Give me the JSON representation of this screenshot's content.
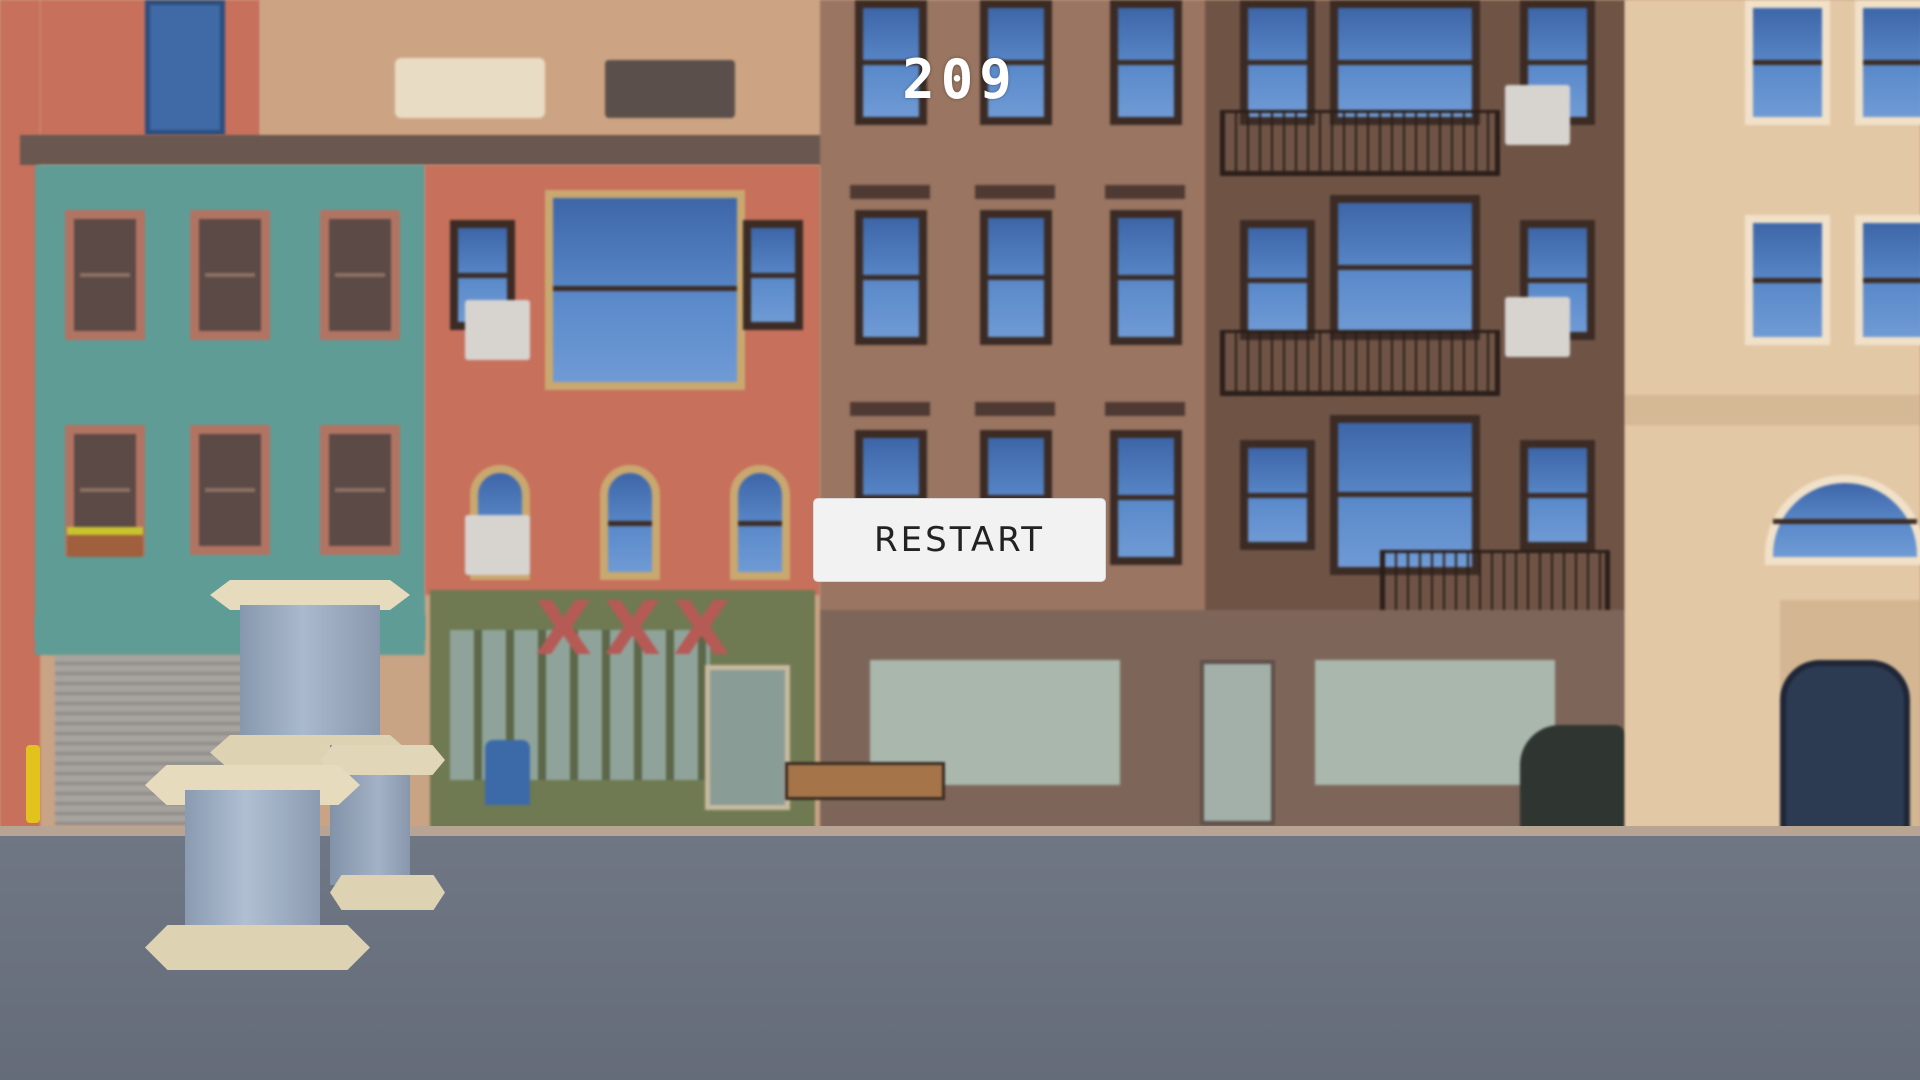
{
  "hud": {
    "score": "209"
  },
  "menu": {
    "restart_label": "RESTART"
  },
  "scene": {
    "setting": "city-street",
    "sign_text": "XXX",
    "colors": {
      "teal_building": "#5f9c96",
      "brick_building": "#c7705c",
      "brown_building": "#9a7561",
      "cream_building": "#e3c8a6",
      "street": "#6d7482",
      "spool_body": "#9aaac0",
      "spool_rim": "#e6dcbd"
    }
  }
}
